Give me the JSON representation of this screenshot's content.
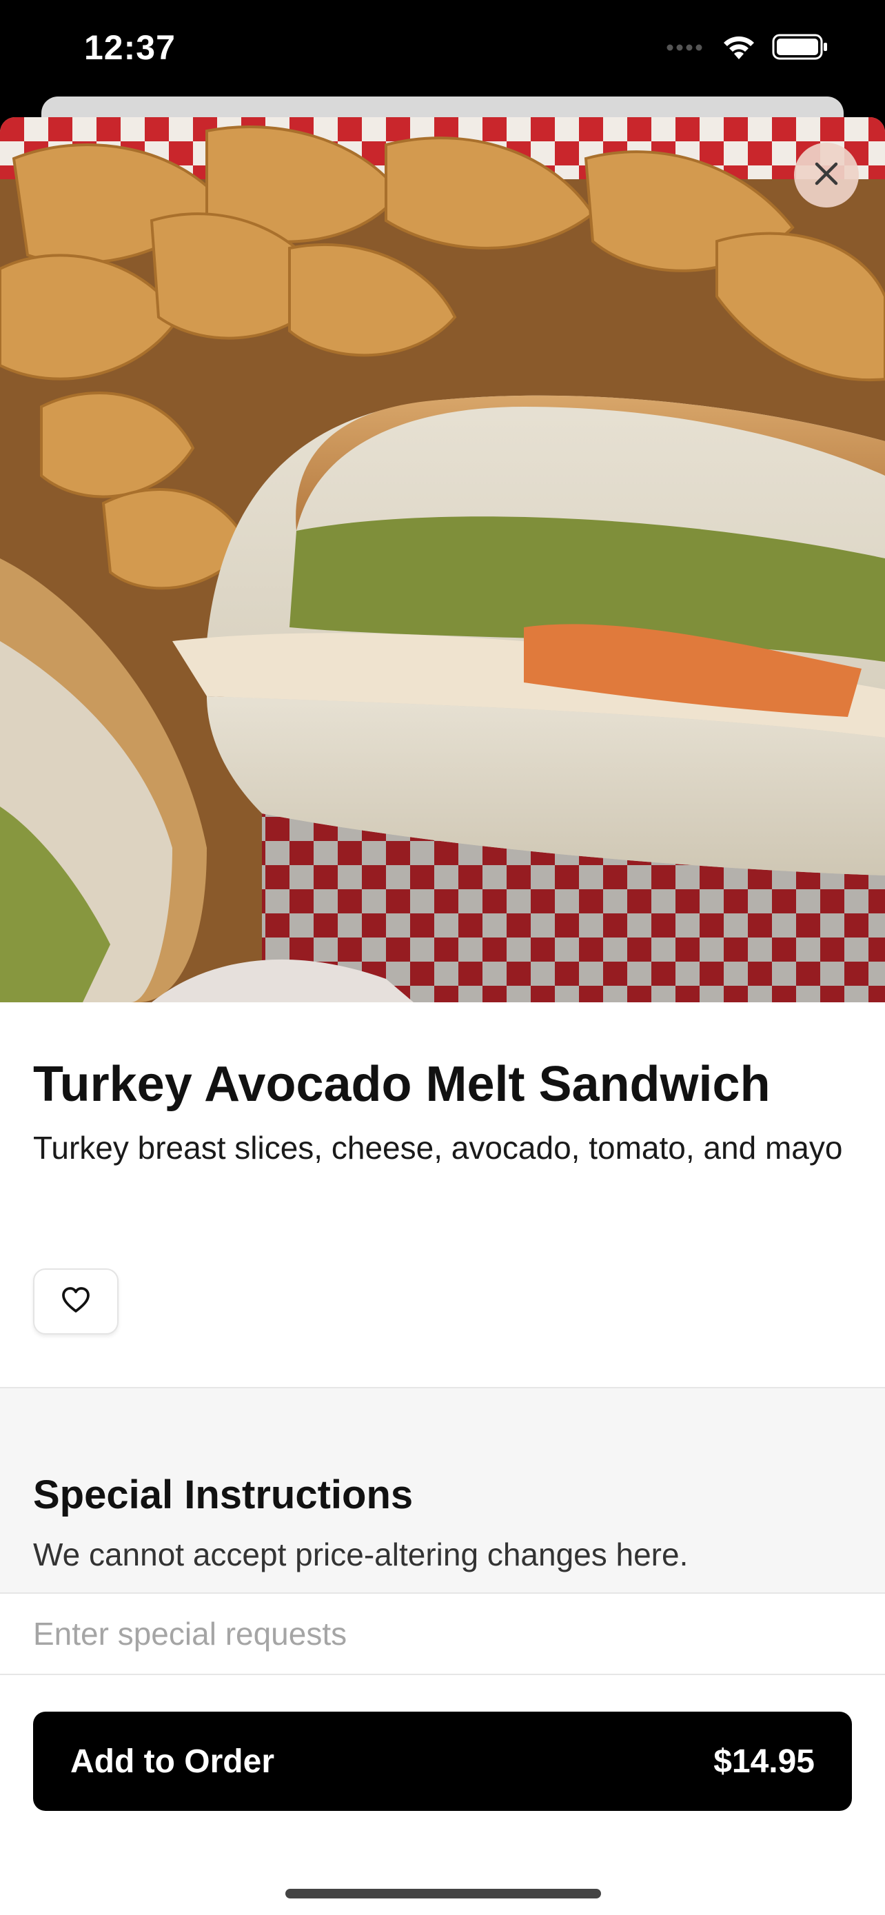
{
  "status_bar": {
    "time": "12:37",
    "icons": [
      "cellular-signal-icon",
      "wifi-icon",
      "battery-icon"
    ]
  },
  "item": {
    "image_alt": "Turkey Avocado Melt Sandwich",
    "name": "Turkey Avocado Melt Sandwich",
    "description": "Turkey breast slices, cheese, avocado, tomato, and mayo"
  },
  "actions": {
    "close_icon": "close-icon",
    "favorite_icon": "heart-icon"
  },
  "special_instructions": {
    "title": "Special Instructions",
    "subtitle": "We cannot accept price-altering changes here.",
    "placeholder": "Enter special requests",
    "value": ""
  },
  "order": {
    "add_label": "Add to Order",
    "price": "$14.95"
  },
  "colors": {
    "primary_button": "#000000",
    "section_background": "#f6f6f6",
    "close_button_bg": "#eed2c8"
  }
}
